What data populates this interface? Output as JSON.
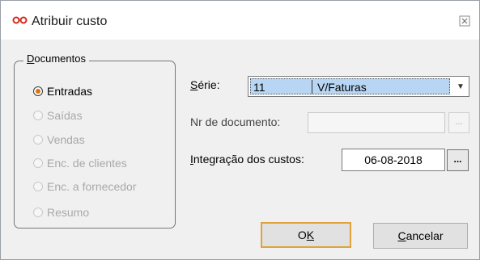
{
  "window": {
    "title": "Atribuir custo"
  },
  "documentos": {
    "legend_u": "D",
    "legend_rest": "ocumentos",
    "options": [
      {
        "label": "Entradas",
        "checked": true,
        "enabled": true
      },
      {
        "label": "Saídas",
        "checked": false,
        "enabled": false
      },
      {
        "label": "Vendas",
        "checked": false,
        "enabled": false
      },
      {
        "label": "Enc. de clientes",
        "checked": false,
        "enabled": false
      },
      {
        "label": "Enc. a fornecedor",
        "checked": false,
        "enabled": false
      },
      {
        "label": "Resumo",
        "checked": false,
        "enabled": false
      }
    ]
  },
  "serie": {
    "label_u": "S",
    "label_rest": "érie:",
    "code": "11",
    "description": "V/Faturas"
  },
  "nr_documento": {
    "label": "Nr de documento:",
    "value": "",
    "button": "..."
  },
  "integracao": {
    "label_u": "I",
    "label_rest": "ntegração dos custos:",
    "date": "06-08-2018",
    "button": "..."
  },
  "buttons": {
    "ok_prefix": "O",
    "ok_u": "K",
    "cancel_u": "C",
    "cancel_rest": "ancelar"
  },
  "colors": {
    "accent": "#d9730d",
    "selection": "#b8d6f4",
    "default_border": "#e0a23a"
  }
}
